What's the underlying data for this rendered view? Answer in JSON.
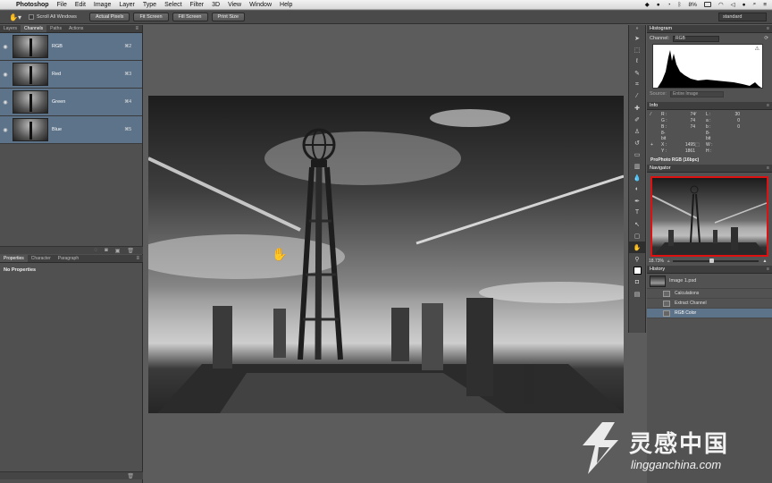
{
  "menubar": {
    "app_name": "Photoshop",
    "items": [
      "File",
      "Edit",
      "Image",
      "Layer",
      "Type",
      "Select",
      "Filter",
      "3D",
      "View",
      "Window",
      "Help"
    ],
    "battery": "8%"
  },
  "options_bar": {
    "scroll_all_windows": "Scroll All Windows",
    "actual_pixels": "Actual Pixels",
    "fit_screen": "Fit Screen",
    "fill_screen": "Fill Screen",
    "print_size": "Print Size",
    "workspace": "standard"
  },
  "channels_panel": {
    "tabs": [
      "Layers",
      "Channels",
      "Paths",
      "Actions"
    ],
    "rows": [
      {
        "name": "RGB",
        "key": "⌘2"
      },
      {
        "name": "Red",
        "key": "⌘3"
      },
      {
        "name": "Green",
        "key": "⌘4"
      },
      {
        "name": "Blue",
        "key": "⌘5"
      }
    ]
  },
  "properties_panel": {
    "tabs": [
      "Properties",
      "Character",
      "Paragraph"
    ],
    "empty_text": "No Properties"
  },
  "histogram": {
    "title": "Histogram",
    "channel_label": "Channel:",
    "channel_value": "RGB",
    "source_label": "Source:",
    "source_value": "Entire Image"
  },
  "info": {
    "title": "Info",
    "r": "74",
    "g": "74",
    "b": "74",
    "l": "30",
    "a": "0",
    "b2": "0",
    "bits_left": "8-bit",
    "bits_right": "8-bit",
    "x": "1495",
    "y": "1861",
    "w": "",
    "h": "",
    "profile": "ProPhoto RGB (16bpc)"
  },
  "navigator": {
    "title": "Navigator",
    "zoom": "18.73%",
    "zoom_level": 0.45
  },
  "history": {
    "title": "History",
    "snapshot": "Image 1.psd",
    "steps": [
      "Calculations",
      "Extract Channel",
      "RGB Color"
    ]
  },
  "watermark": {
    "title": "灵感中国",
    "url": "lingganchina.com"
  }
}
